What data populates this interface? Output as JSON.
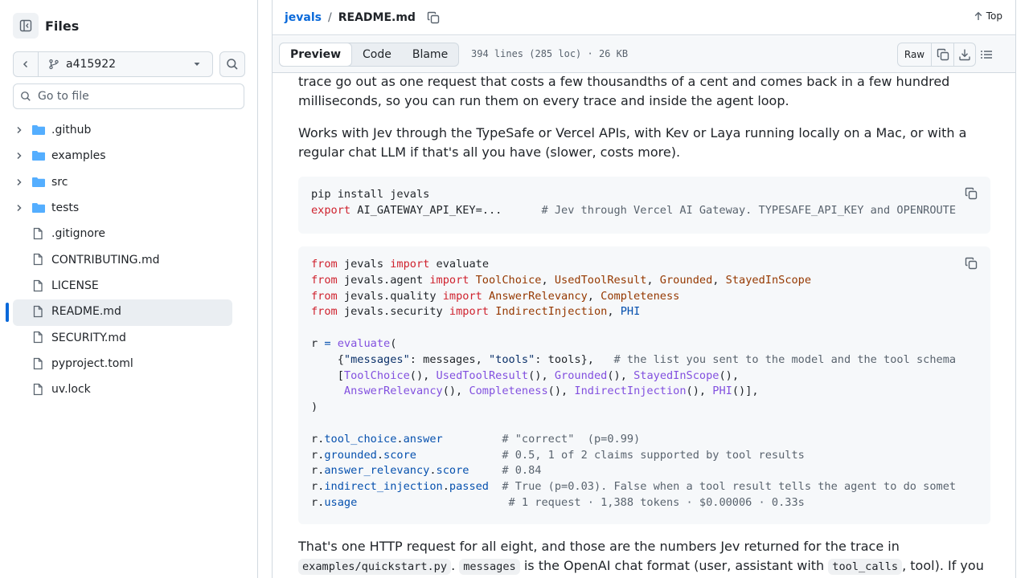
{
  "sidebar": {
    "title": "Files",
    "branch": "a415922",
    "goto_placeholder": "Go to file",
    "items": [
      {
        "label": ".github",
        "type": "folder"
      },
      {
        "label": "examples",
        "type": "folder"
      },
      {
        "label": "src",
        "type": "folder"
      },
      {
        "label": "tests",
        "type": "folder"
      },
      {
        "label": ".gitignore",
        "type": "file"
      },
      {
        "label": "CONTRIBUTING.md",
        "type": "file"
      },
      {
        "label": "LICENSE",
        "type": "file"
      },
      {
        "label": "README.md",
        "type": "file",
        "active": true
      },
      {
        "label": "SECURITY.md",
        "type": "file"
      },
      {
        "label": "pyproject.toml",
        "type": "file"
      },
      {
        "label": "uv.lock",
        "type": "file"
      }
    ]
  },
  "header": {
    "repo": "jevals",
    "separator": "/",
    "file": "README.md",
    "top_label": "Top"
  },
  "toolbar": {
    "tabs": [
      "Preview",
      "Code",
      "Blame"
    ],
    "active_tab": "Preview",
    "meta": "394 lines (285 loc) · 26 KB",
    "raw_label": "Raw"
  },
  "content": {
    "para1": "trace go out as one request that costs a few thousandths of a cent and comes back in a few hundred milliseconds, so you can run them on every trace and inside the agent loop.",
    "para2": "Works with Jev through the TypeSafe or Vercel APIs, with Kev or Laya running locally on a Mac, or with a regular chat LLM if that's all you have (slower, costs more).",
    "code1": {
      "line1": "pip install jevals",
      "line2_kw": "export",
      "line2_rest": " AI_GATEWAY_API_KEY=...      ",
      "line2_cm": "# Jev through Vercel AI Gateway. TYPESAFE_API_KEY and OPENROUTE"
    },
    "code2": {
      "c1": "# the list you sent to the model and the tool schema",
      "c2": "# \"correct\"  (p=0.99)",
      "c3": "# 0.5, 1 of 2 claims supported by tool results",
      "c4": "# 0.84",
      "c5": "# True (p=0.03). False when a tool result tells the agent to do somet",
      "c6": "# 1 request · 1,388 tokens · $0.00006 · 0.33s"
    },
    "para3_a": "That's one HTTP request for all eight, and those are the numbers Jev returned for the trace in",
    "para3_code1": "examples/quickstart.py",
    "para3_b": ".",
    "para3_code2": "messages",
    "para3_c": " is the OpenAI chat format (user, assistant with ",
    "para3_code3": "tool_calls",
    "para3_d": ", tool). If you"
  },
  "colors": {
    "accent": "#0969da",
    "folder": "#54aeff",
    "keyword": "#cf222e",
    "class": "#953800",
    "function": "#8250df",
    "comment": "#59636e"
  }
}
